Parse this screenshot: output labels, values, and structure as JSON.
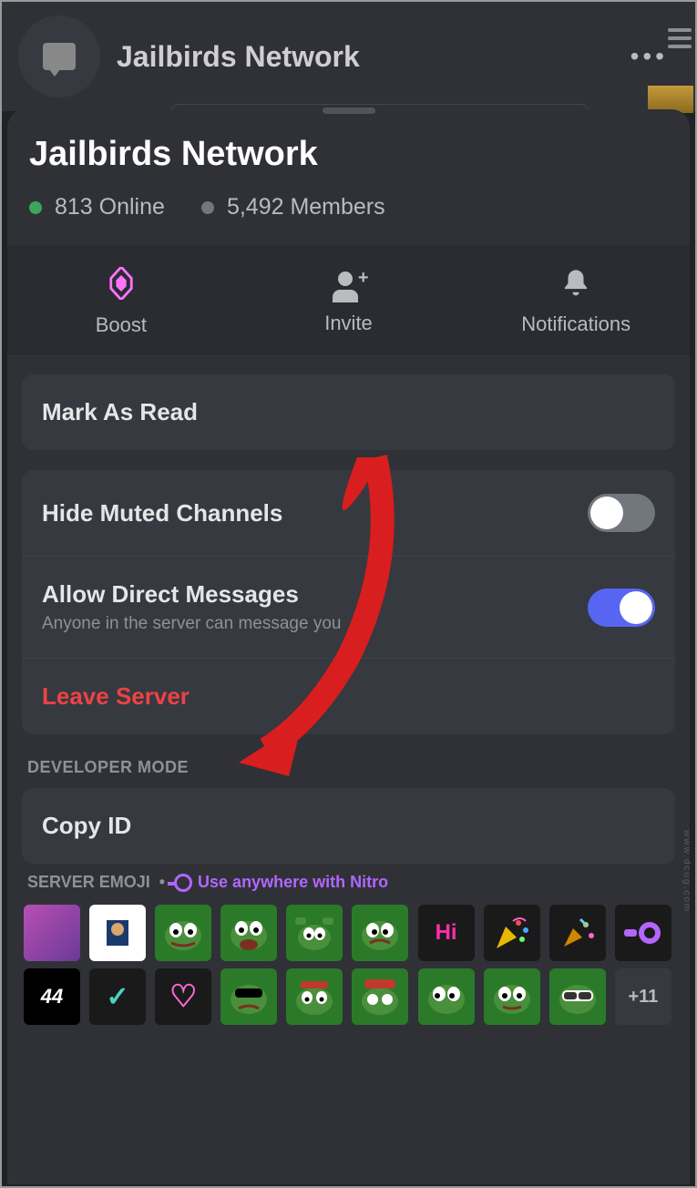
{
  "header": {
    "server_name": "Jailbirds Network"
  },
  "sheet": {
    "title": "Jailbirds Network",
    "online_count": "813 Online",
    "members_count": "5,492 Members"
  },
  "tabs": {
    "boost": "Boost",
    "invite": "Invite",
    "notifications": "Notifications"
  },
  "actions": {
    "mark_as_read": "Mark As Read",
    "hide_muted": "Hide Muted Channels",
    "allow_dm": "Allow Direct Messages",
    "allow_dm_sub": "Anyone in the server can message you",
    "leave": "Leave Server",
    "copy_id": "Copy ID"
  },
  "sections": {
    "developer_mode": "DEVELOPER MODE",
    "server_emoji": "SERVER EMOJI",
    "nitro_hint": "Use anywhere with Nitro"
  },
  "emoji": {
    "r1": [
      "",
      "",
      "",
      "",
      "",
      "",
      "Hi",
      "",
      "",
      ""
    ],
    "r2": [
      "44",
      "✓",
      "♡",
      "",
      "",
      "",
      "",
      "",
      "",
      "+11"
    ]
  },
  "watermark": "www.dcug.com"
}
